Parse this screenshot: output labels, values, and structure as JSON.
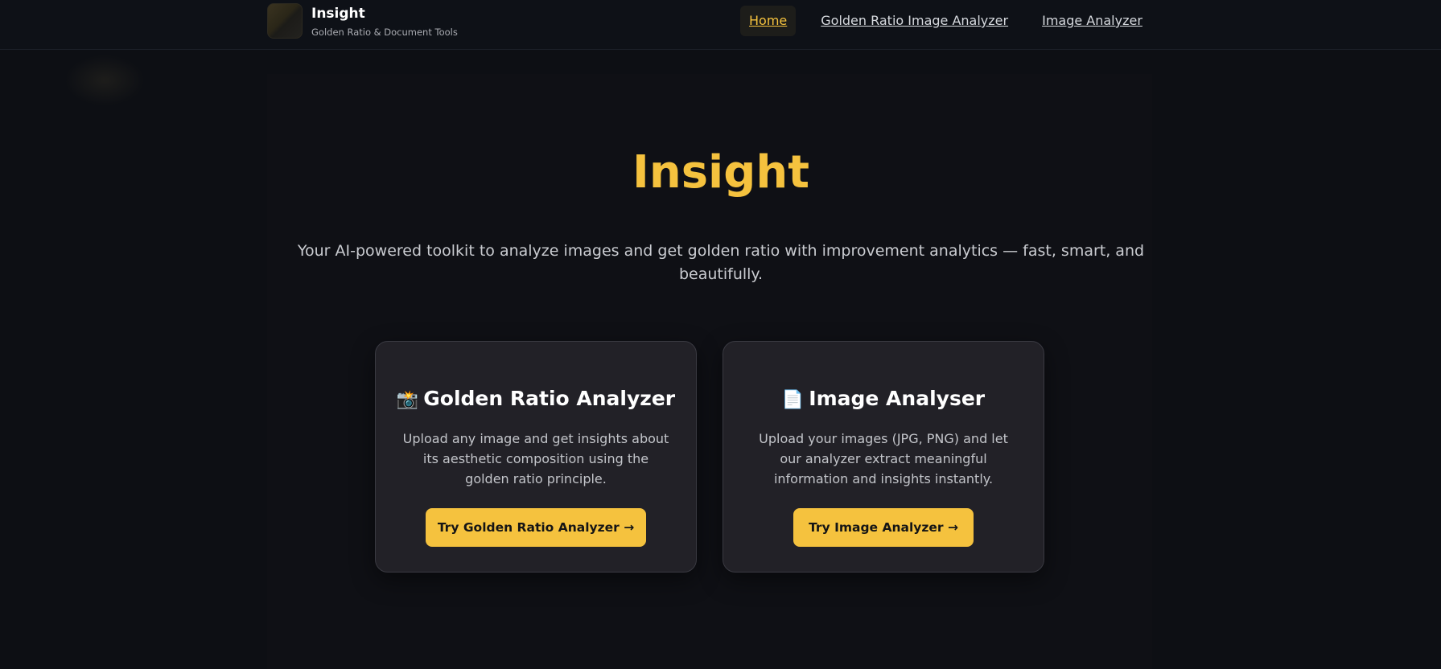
{
  "header": {
    "brand_title": "Insight",
    "brand_subtitle": "Golden Ratio & Document Tools",
    "nav": {
      "home": "Home",
      "golden": "Golden Ratio Image Analyzer",
      "image": "Image Analyzer"
    }
  },
  "hero": {
    "title": "Insight",
    "subtitle": "Your AI-powered toolkit to analyze images and get golden ratio with improvement analytics — fast, smart, and beautifully."
  },
  "cards": [
    {
      "icon": "📸",
      "icon_name": "camera-flash-icon",
      "title": "Golden Ratio Analyzer",
      "description": "Upload any image and get insights about its aesthetic composition using the golden ratio principle.",
      "button": "Try Golden Ratio Analyzer →"
    },
    {
      "icon": "📄",
      "icon_name": "document-icon",
      "title": "Image Analyser",
      "description": "Upload your images (JPG, PNG) and let our analyzer extract meaningful information and insights instantly.",
      "button": "Try Image Analyzer →"
    }
  ],
  "colors": {
    "accent": "#f5c23e",
    "background": "#0d0f14",
    "card": "#222127"
  }
}
